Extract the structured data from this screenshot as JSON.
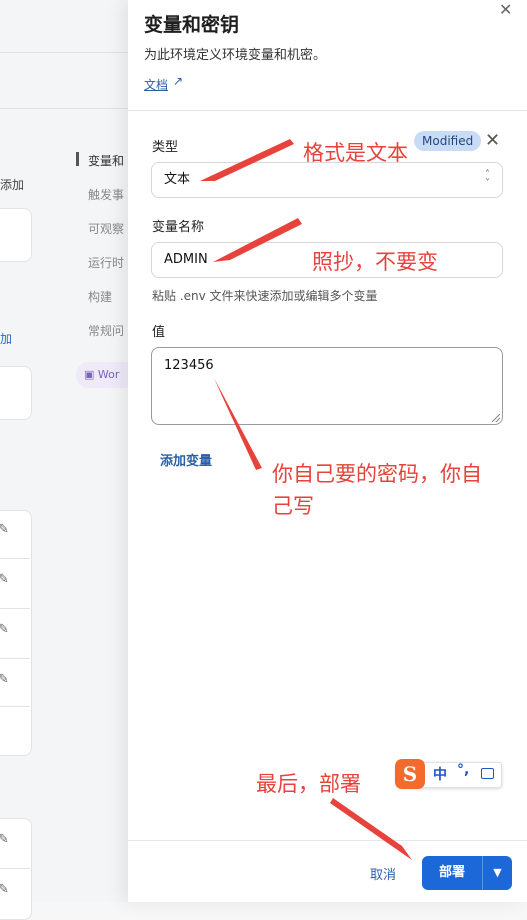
{
  "background": {
    "add_text": "添加",
    "link_text": "加",
    "nav": [
      "变量和",
      "触发事",
      "可观察",
      "运行时",
      "构建",
      "常规问"
    ],
    "chip": "Wor"
  },
  "drawer": {
    "title": "变量和密钥",
    "subtitle": "为此环境定义环境变量和机密。",
    "doc_link": "文档",
    "type_label": "类型",
    "type_value": "文本",
    "modified_badge": "Modified",
    "name_label": "变量名称",
    "name_value": "ADMIN",
    "helper": "粘贴 .env 文件来快速添加或编辑多个变量",
    "value_label": "值",
    "value_value": "123456",
    "add_variable": "添加变量",
    "cancel": "取消",
    "deploy": "部署"
  },
  "annotations": {
    "format": "格式是文本",
    "copy": "照抄，不要变",
    "password_line1": "你自己要的密码，你自",
    "password_line2": "己写",
    "deploy_note": "最后，部署",
    "arrow_color": "#e8423c"
  },
  "ime": {
    "logo": "S",
    "mode": "中",
    "punct": "°,"
  }
}
